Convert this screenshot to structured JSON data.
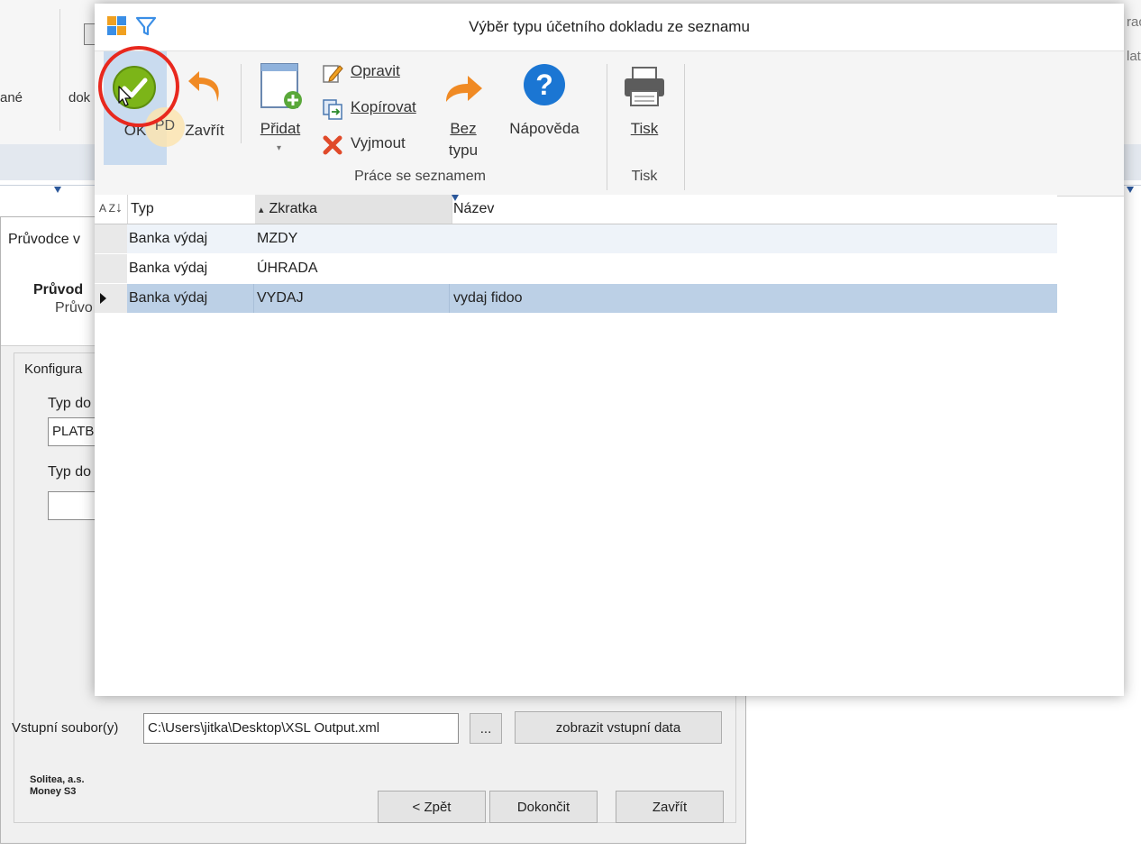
{
  "background": {
    "ribbon_left_text": "ané",
    "ribbon_mid_text": "dok",
    "ribbon_right_top": "rac",
    "ribbon_right_mid": "lat"
  },
  "wizard": {
    "title": "Průvodce v",
    "header_title": "Průvod",
    "header_subtitle": "Průvo",
    "group_label": "Konfigura",
    "field1_label": "Typ do",
    "field1_value": "PLATB",
    "field2_label": "Typ do",
    "field2_value": "",
    "input_files_label": "Vstupní soubor(y)",
    "input_files_value": "C:\\Users\\jitka\\Desktop\\XSL Output.xml",
    "browse_label": "...",
    "show_data_label": "zobrazit vstupní data",
    "company_line1": "Solitea, a.s.",
    "company_line2": "Money S3",
    "back_label": "< Zpět",
    "finish_label": "Dokončit",
    "close_label": "Zavřít"
  },
  "dialog": {
    "title": "Výběr typu účetního dokladu ze seznamu",
    "ribbon": {
      "ok_label": "OK",
      "close_label": "Zavřít",
      "add_label": "Přidat",
      "edit_label": "Opravit",
      "copy_label": "Kopírovat",
      "cut_label": "Vyjmout",
      "notype_label_1": "Bez",
      "notype_label_2": "typu",
      "help_label": "Nápověda",
      "print_label": "Tisk",
      "group_list_label": "Práce se seznamem",
      "group_print_label": "Tisk"
    },
    "cursor_badge": "PD",
    "grid": {
      "sort_icon_text": "A Z",
      "columns": [
        "Typ",
        "Zkratka",
        "Název"
      ],
      "sort_indicator": "▴",
      "rows": [
        {
          "typ": "Banka výdaj",
          "zkratka": "MZDY",
          "nazev": ""
        },
        {
          "typ": "Banka výdaj",
          "zkratka": "ÚHRADA",
          "nazev": ""
        },
        {
          "typ": "Banka výdaj",
          "zkratka": "VYDAJ",
          "nazev": "vydaj fidoo"
        }
      ],
      "selected_row": 2
    }
  },
  "colors": {
    "selection": "#bcd0e6",
    "highlight_circle": "#e8281e",
    "ok_green": "#7cb518",
    "help_blue": "#1b76d3",
    "arrow_orange": "#f08a24"
  }
}
